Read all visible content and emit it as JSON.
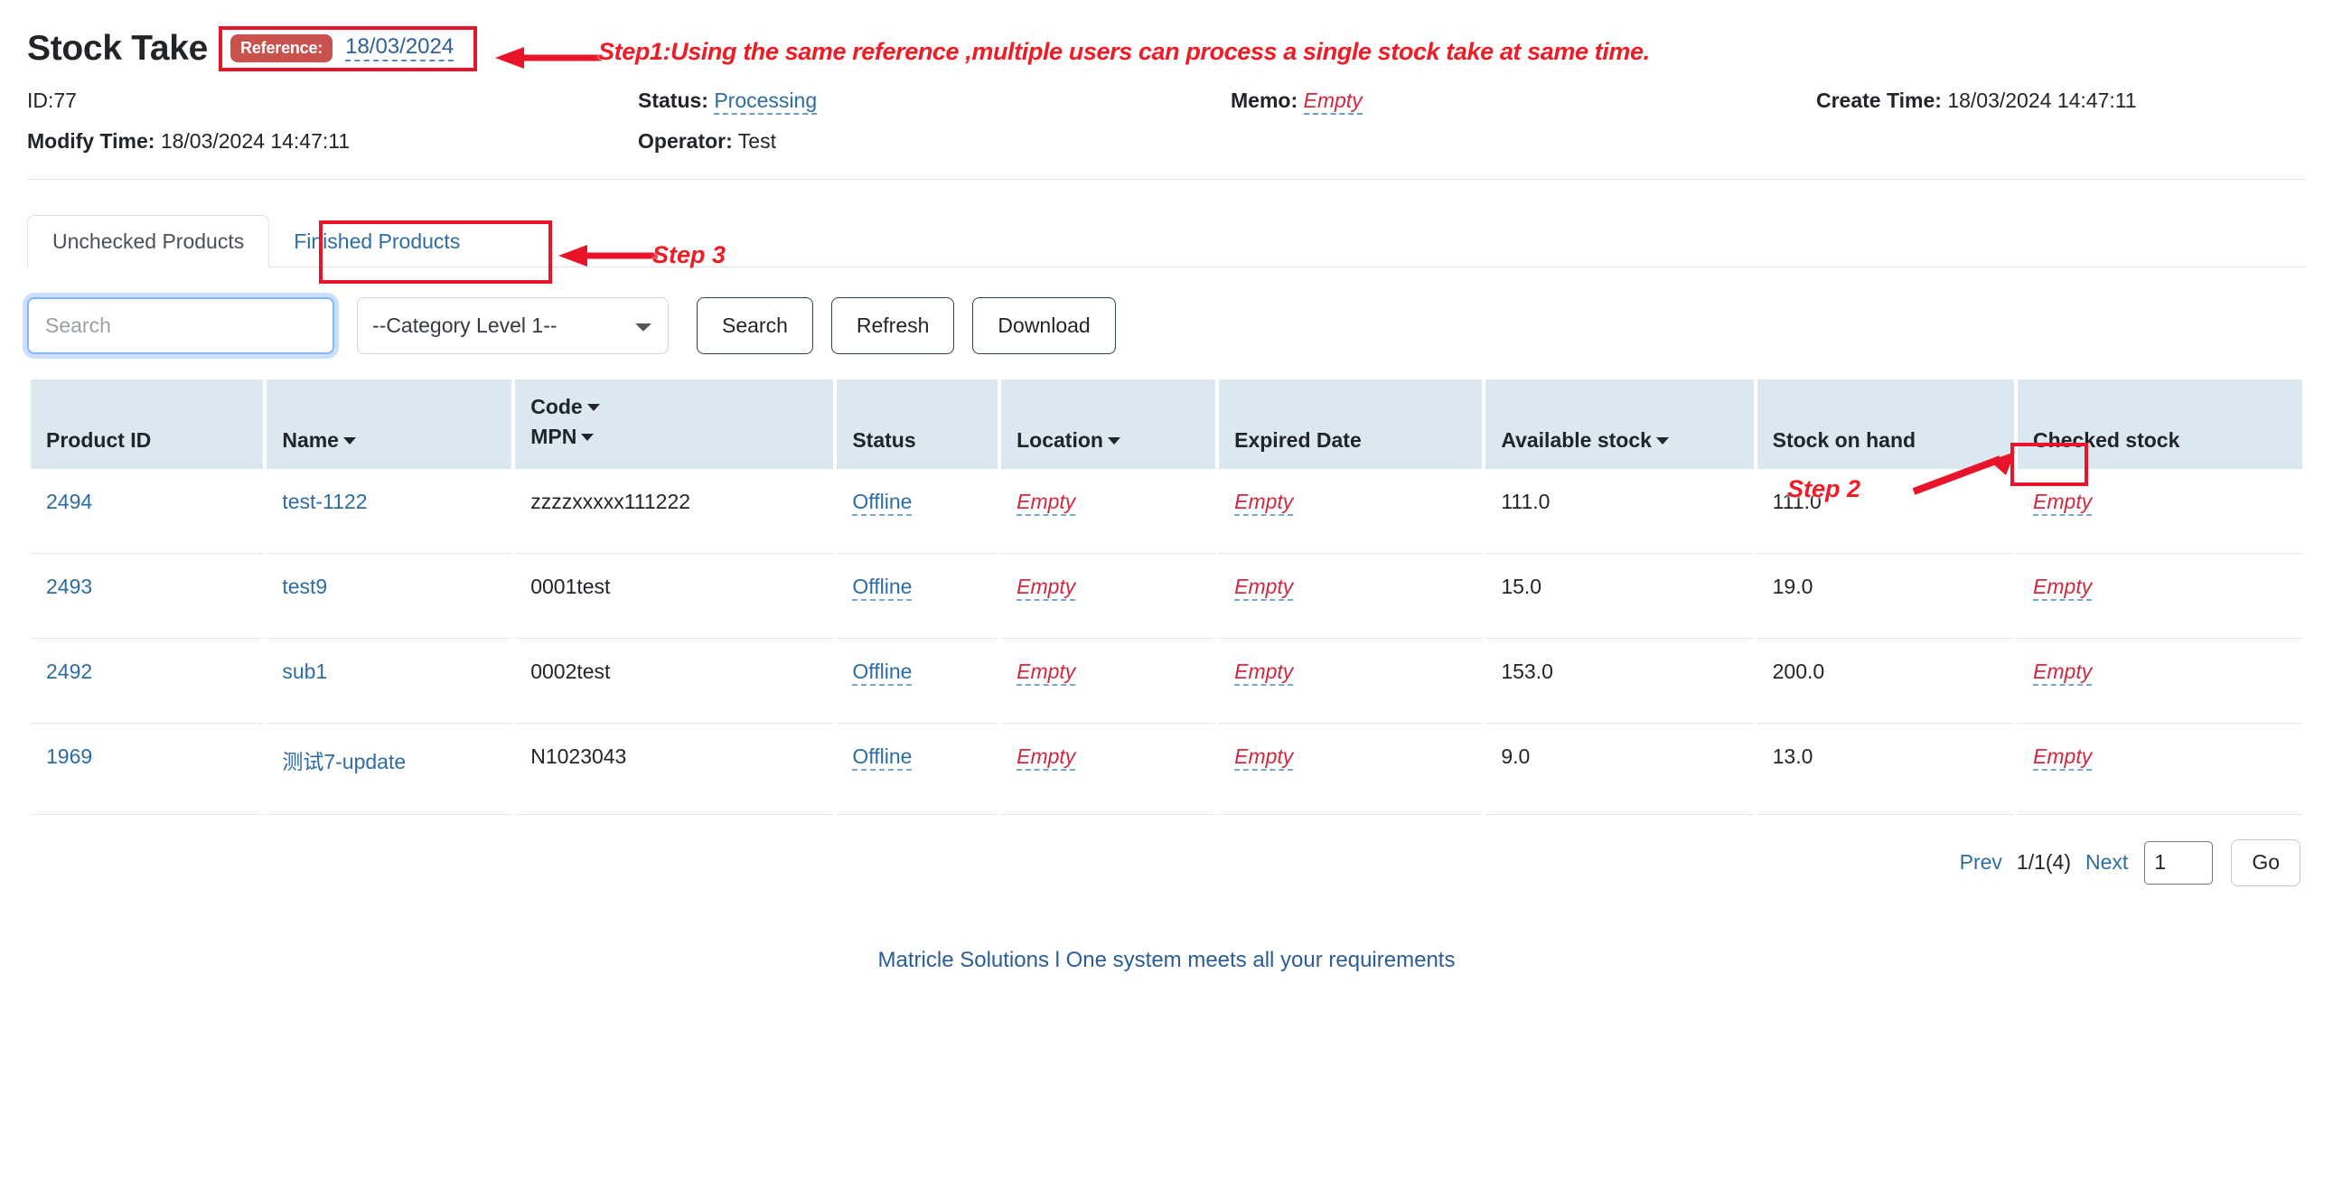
{
  "header": {
    "title": "Stock Take",
    "reference_label": "Reference:",
    "reference_value": "18/03/2024",
    "id_label": "ID:77",
    "status_label": "Status:",
    "status_value": "Processing",
    "memo_label": "Memo:",
    "memo_value": "Empty",
    "create_time_label": "Create Time:",
    "create_time_value": "18/03/2024 14:47:11",
    "modify_time_label": "Modify Time:",
    "modify_time_value": "18/03/2024 14:47:11",
    "operator_label": "Operator:",
    "operator_value": "Test"
  },
  "annotations": {
    "step1": "Step1:Using the same reference ,multiple users can process a single stock take at same time.",
    "step2": "Step 2",
    "step3": "Step 3",
    "accent_color": "#ee1c25"
  },
  "tabs": [
    {
      "label": "Unchecked Products",
      "active": true
    },
    {
      "label": "Finished Products",
      "active": false
    }
  ],
  "toolbar": {
    "search_placeholder": "Search",
    "search_value": "",
    "category_selected": "--Category Level 1--",
    "category_options": [
      "--Category Level 1--"
    ],
    "search_label": "Search",
    "refresh_label": "Refresh",
    "download_label": "Download"
  },
  "table": {
    "columns": [
      {
        "label": "Product ID",
        "sortable": false
      },
      {
        "label": "Name",
        "sortable": true
      },
      {
        "label_top": "Code",
        "label_bottom": "MPN",
        "sortable": true
      },
      {
        "label": "Status",
        "sortable": false
      },
      {
        "label": "Location",
        "sortable": true
      },
      {
        "label": "Expired Date",
        "sortable": false
      },
      {
        "label": "Available stock",
        "sortable": true
      },
      {
        "label": "Stock on hand",
        "sortable": false
      },
      {
        "label": "Checked stock",
        "sortable": false
      }
    ],
    "rows": [
      {
        "product_id": "2494",
        "name": "test-1122",
        "code": "zzzzxxxxx111222",
        "status": "Offline",
        "location": "Empty",
        "expired_date": "Empty",
        "available_stock": "111.0",
        "stock_on_hand": "111.0",
        "checked_stock": "Empty"
      },
      {
        "product_id": "2493",
        "name": "test9",
        "code": "0001test",
        "status": "Offline",
        "location": "Empty",
        "expired_date": "Empty",
        "available_stock": "15.0",
        "stock_on_hand": "19.0",
        "checked_stock": "Empty"
      },
      {
        "product_id": "2492",
        "name": "sub1",
        "code": "0002test",
        "status": "Offline",
        "location": "Empty",
        "expired_date": "Empty",
        "available_stock": "153.0",
        "stock_on_hand": "200.0",
        "checked_stock": "Empty"
      },
      {
        "product_id": "1969",
        "name": "测试7-update",
        "code": "N1023043",
        "status": "Offline",
        "location": "Empty",
        "expired_date": "Empty",
        "available_stock": "9.0",
        "stock_on_hand": "13.0",
        "checked_stock": "Empty"
      }
    ]
  },
  "pagination": {
    "prev_label": "Prev",
    "page_indicator": "1/1(4)",
    "next_label": "Next",
    "page_input_value": "1",
    "go_label": "Go"
  },
  "footer": {
    "text": "Matricle Solutions l One system meets all your requirements"
  }
}
